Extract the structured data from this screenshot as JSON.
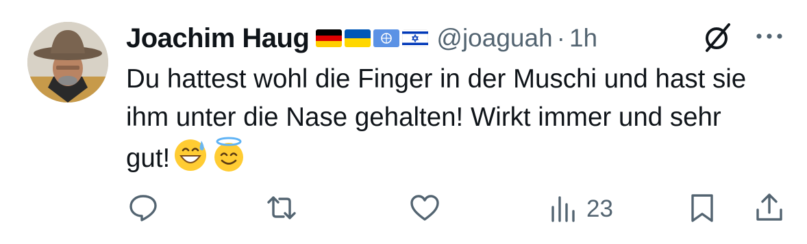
{
  "author": {
    "name": "Joachim Haug",
    "handle": "@joaguah",
    "separator": "·",
    "time": "1h",
    "flags": [
      "germany-flag",
      "ukraine-flag",
      "united-nations-flag",
      "israel-flag"
    ]
  },
  "tweet": {
    "text": "Du hattest wohl die Finger in der Muschi und hast sie ihm unter die Nase gehalten! Wirkt immer und sehr gut!",
    "emojis": [
      "grinning-face-with-sweat",
      "smiling-face-with-halo"
    ]
  },
  "actions": {
    "views_count": "23"
  },
  "icons": {
    "reply": "reply-icon",
    "retweet": "retweet-icon",
    "like": "heart-icon",
    "views": "views-icon",
    "bookmark": "bookmark-icon",
    "share": "share-icon",
    "grok": "grok-icon",
    "more": "more-icon"
  },
  "colors": {
    "text": "#0f1419",
    "secondary": "#536471",
    "background": "#ffffff"
  }
}
